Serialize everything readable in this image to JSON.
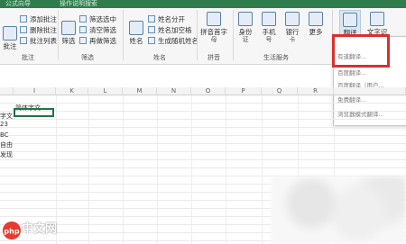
{
  "title_strip": {
    "left": "公式向导",
    "right": "操作说明搜索"
  },
  "ribbon": {
    "comment_group": {
      "big_button": "批注",
      "items": [
        "添加批注",
        "删除批注",
        "批注列表"
      ],
      "title": "批注"
    },
    "filter_group": {
      "big_button": "筛选",
      "items": [
        "筛选选中",
        "清空筛选",
        "再做筛选"
      ],
      "title": "筛选"
    },
    "name_group": {
      "big_button": "姓名",
      "items": [
        "姓名分开",
        "姓名加空格",
        "生成随机姓名"
      ],
      "title": "姓名"
    },
    "pinyin_group": {
      "big_button": "拼音首字",
      "big_button_sub": "母",
      "title": "拼音"
    },
    "life_group": {
      "buttons": [
        {
          "label": "身份",
          "sub": "证"
        },
        {
          "label": "手机",
          "sub": "号"
        },
        {
          "label": "银行",
          "sub": "卡"
        },
        {
          "label": "更多",
          "sub": ""
        }
      ],
      "title": "生活服务"
    },
    "translate_group": {
      "buttons": [
        {
          "label": "翻译",
          "sub": ""
        },
        {
          "label": "文字识",
          "sub": "别"
        }
      ]
    }
  },
  "dropdown": {
    "items": [
      "有道翻译...",
      "百度翻译...",
      "百度翻译（用户...",
      "免费翻译...",
      "浏览器模式翻译..."
    ]
  },
  "grid": {
    "columns": [
      "I",
      "K",
      "L",
      "M",
      "N",
      "O",
      "P",
      "Q",
      "R"
    ],
    "header_cell": "简体字文",
    "row_fragments": [
      "字文",
      "23",
      "BC",
      "自由",
      "发现"
    ]
  },
  "watermark": {
    "brand": "中文网",
    "domain": "php"
  }
}
